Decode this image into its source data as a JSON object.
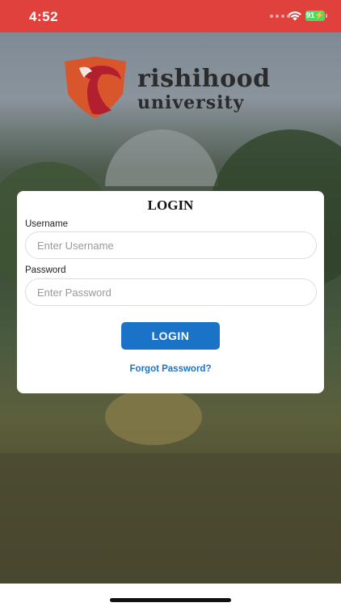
{
  "status_bar": {
    "time": "4:52",
    "battery_level": "91",
    "color": "#e0413d"
  },
  "logo": {
    "line1": "rishihood",
    "line2": "university",
    "shield_colors": [
      "#d9552b",
      "#b21f2f"
    ]
  },
  "login_card": {
    "title": "LOGIN",
    "username": {
      "label": "Username",
      "placeholder": "Enter Username",
      "value": ""
    },
    "password": {
      "label": "Password",
      "placeholder": "Enter Password",
      "value": ""
    },
    "login_button": "LOGIN",
    "forgot_link": "Forgot Password?",
    "accent_color": "#1b73c7"
  }
}
